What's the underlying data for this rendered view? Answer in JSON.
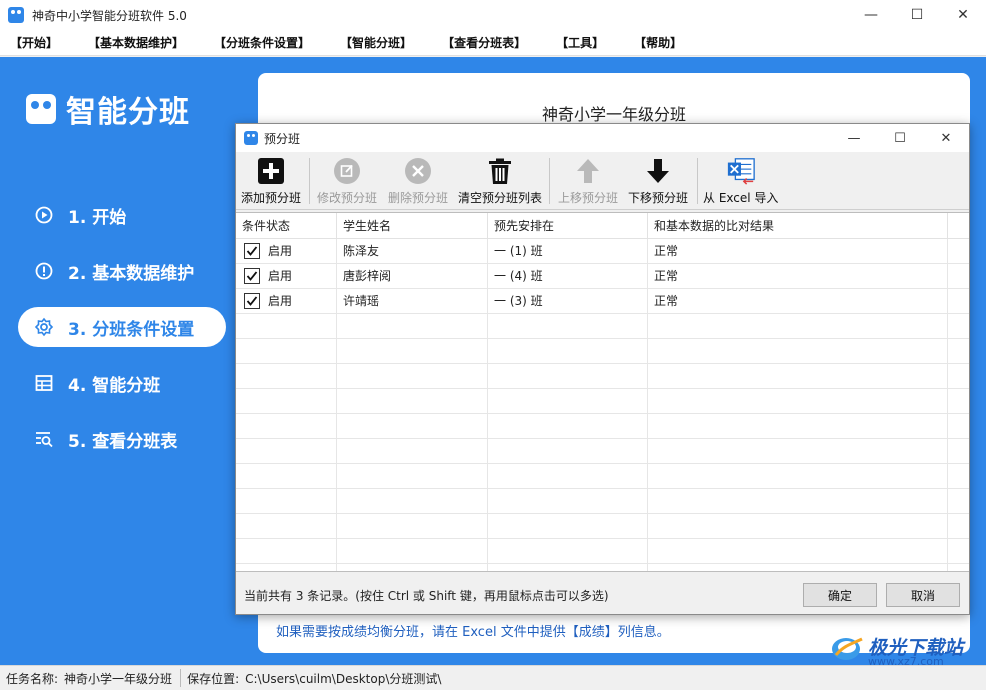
{
  "window": {
    "title": "神奇中小学智能分班软件 5.0",
    "minimize": "—",
    "maximize": "☐",
    "close": "✕"
  },
  "menu": [
    "【开始】",
    "【基本数据维护】",
    "【分班条件设置】",
    "【智能分班】",
    "【查看分班表】",
    "【工具】",
    "【帮助】"
  ],
  "sidebar": {
    "brand": "智能分班",
    "items": [
      {
        "label": "1. 开始",
        "icon": "play-icon"
      },
      {
        "label": "2. 基本数据维护",
        "icon": "info-icon"
      },
      {
        "label": "3. 分班条件设置",
        "icon": "gear-icon"
      },
      {
        "label": "4. 智能分班",
        "icon": "table-icon"
      },
      {
        "label": "5. 查看分班表",
        "icon": "search-list-icon"
      }
    ],
    "active_index": 2
  },
  "content": {
    "title": "神奇小学一年级分班",
    "hint": "如果需要按成绩均衡分班，请在 Excel 文件中提供【成绩】列信息。"
  },
  "dialog": {
    "title": "预分班",
    "toolbar": {
      "add": "添加预分班",
      "edit": "修改预分班",
      "delete": "删除预分班",
      "clear": "清空预分班列表",
      "move_up": "上移预分班",
      "move_down": "下移预分班",
      "import_excel": "从 Excel 导入"
    },
    "columns": [
      "条件状态",
      "学生姓名",
      "预先安排在",
      "和基本数据的比对结果"
    ],
    "rows": [
      {
        "checked": true,
        "status": "启用",
        "name": "陈泽友",
        "class": "一 (1) 班",
        "result": "正常"
      },
      {
        "checked": true,
        "status": "启用",
        "name": "唐彭梓阅",
        "class": "一 (4) 班",
        "result": "正常"
      },
      {
        "checked": true,
        "status": "启用",
        "name": "许靖瑶",
        "class": "一 (3) 班",
        "result": "正常"
      }
    ],
    "record_text": "当前共有 3 条记录。(按住 Ctrl 或 Shift 键，再用鼠标点击可以多选)",
    "ok": "确定",
    "cancel": "取消"
  },
  "status": {
    "task_label": "任务名称:",
    "task_value": "神奇小学一年级分班",
    "save_label": "保存位置:",
    "save_value": "C:\\Users\\cuilm\\Desktop\\分班测试\\"
  },
  "watermark": {
    "text": "极光下载站",
    "sub": "www.xz7.com"
  },
  "colors": {
    "accent": "#2f86e8",
    "hint": "#1f5fbf"
  }
}
